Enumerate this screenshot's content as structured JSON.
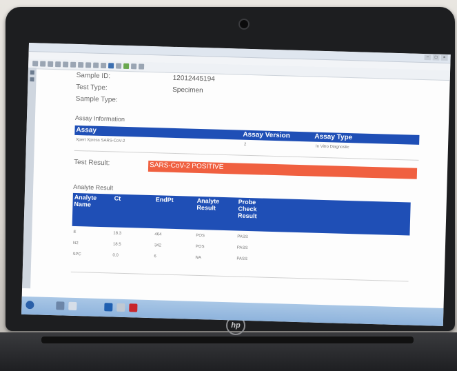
{
  "window": {
    "title_text": "",
    "controls": [
      "–",
      "□",
      "×"
    ],
    "menu": [
      "",
      "",
      "",
      ""
    ],
    "toolbar_right_label": ""
  },
  "sample": {
    "id_label": "Sample ID:",
    "id_value": "12012445194",
    "test_type_label": "Test Type:",
    "test_type_value": "Specimen",
    "sample_type_label": "Sample Type:",
    "sample_type_value": ""
  },
  "assay_info": {
    "section_title": "Assay Information",
    "headers": [
      "Assay",
      "Assay Version",
      "Assay Type"
    ],
    "row": [
      "Xpert Xpress SARS-CoV-2",
      "2",
      "In Vitro Diagnostic"
    ]
  },
  "test_result": {
    "label": "Test Result:",
    "value": "SARS-CoV-2 POSITIVE",
    "color": "#f06040"
  },
  "analyte": {
    "section_title": "Analyte Result",
    "headers": [
      "Analyte Name",
      "Ct",
      "EndPt",
      "Analyte Result",
      "Probe Check Result"
    ],
    "rows": [
      [
        "E",
        "18.3",
        "464",
        "POS",
        "PASS"
      ],
      [
        "N2",
        "18.5",
        "342",
        "POS",
        "PASS"
      ],
      [
        "SPC",
        "0.0",
        "6",
        "NA",
        "PASS"
      ]
    ]
  },
  "footer_partial": [
    "",
    ""
  ],
  "colors": {
    "header_blue": "#1f4fb6",
    "result_red": "#f06040"
  },
  "brand": {
    "logo": "hp"
  }
}
